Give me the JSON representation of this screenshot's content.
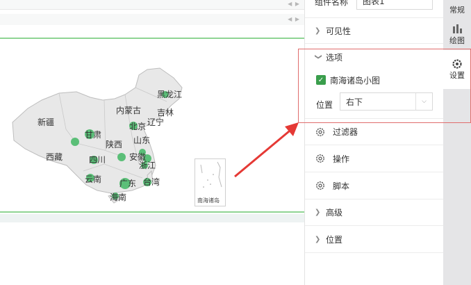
{
  "canvas": {
    "map": {
      "province_labels": [
        "黑龙江",
        "内蒙古",
        "吉林",
        "辽宁",
        "北京",
        "新疆",
        "甘肃",
        "陕西",
        "山东",
        "西藏",
        "安徽",
        "浙江",
        "四川",
        "云南",
        "广东",
        "台湾",
        "海南"
      ],
      "inset_label": "南海诸岛"
    }
  },
  "panel": {
    "component_name_label": "组件名称",
    "component_name_value": "图表1",
    "visibility_label": "可见性",
    "options_label": "选项",
    "south_sea_checkbox_label": "南海诸岛小图",
    "position_label": "位置",
    "position_value": "右下",
    "filter_label": "过滤器",
    "actions_label": "操作",
    "script_label": "脚本",
    "advanced_label": "高级",
    "position_section_label": "位置"
  },
  "rail": {
    "general_label": "常规",
    "draw_label": "绘图",
    "settings_label": "设置"
  },
  "colors": {
    "accent_green": "#3a9e4c",
    "map_dot": "#4cbb6c",
    "annotation_red": "#e53935"
  }
}
